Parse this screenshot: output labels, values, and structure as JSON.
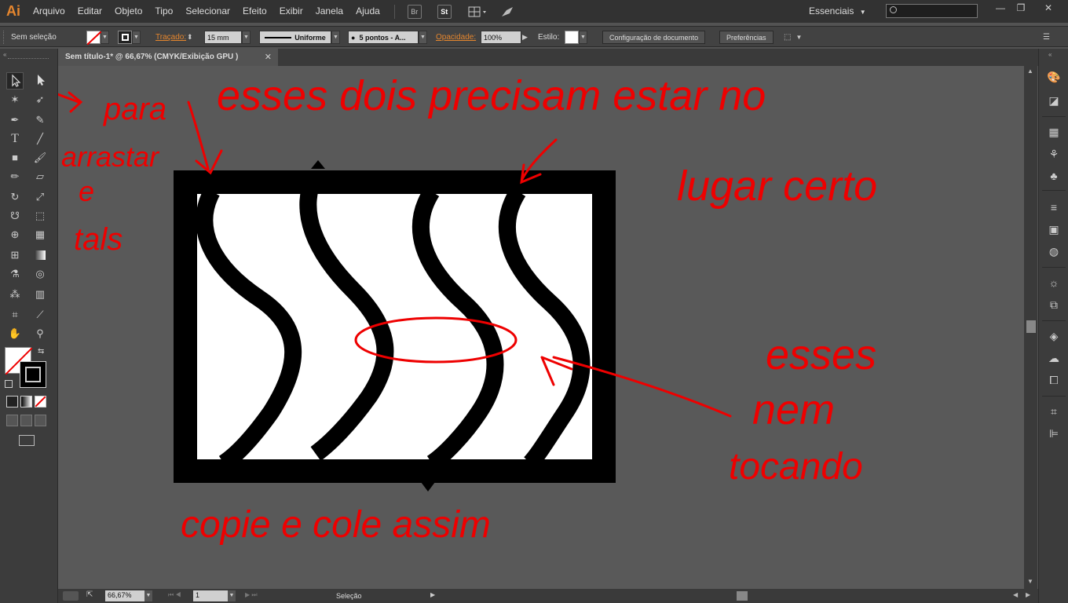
{
  "app": {
    "logo": "Ai"
  },
  "menu": [
    "Arquivo",
    "Editar",
    "Objeto",
    "Tipo",
    "Selecionar",
    "Efeito",
    "Exibir",
    "Janela",
    "Ajuda"
  ],
  "menubar_buttons": [
    "Br",
    "St"
  ],
  "workspace": "Essenciais",
  "control": {
    "selection": "Sem seleção",
    "stroke_label": "Traçado:",
    "stroke_value": "15 mm",
    "profile": "Uniforme",
    "brush": "5 pontos - A...",
    "opacity_label": "Opacidade:",
    "opacity_value": "100%",
    "style_label": "Estilo:",
    "doc_setup": "Configuração de documento",
    "prefs": "Preferências"
  },
  "document": {
    "tab_title": "Sem título-1* @ 66,67% (CMYK/Exibição GPU )",
    "close": "✕"
  },
  "status": {
    "zoom": "66,67%",
    "artboard": "1",
    "tool": "Seleção"
  },
  "annotations": {
    "arrow_note_1": "para",
    "arrow_note_2": "arrastar",
    "arrow_note_3": "e",
    "arrow_note_4": "tals",
    "top_note": "esses dois precisam estar no",
    "top_note_2": "lugar certo",
    "right_note_1": "esses",
    "right_note_2": "nem",
    "right_note_3": "tocando",
    "bottom_note": "copie e cole assim"
  },
  "colors": {
    "annotation_red": "#ee0000",
    "accent_orange": "#e5862e"
  },
  "icons": {
    "toolbox": [
      "selection-tool",
      "direct-selection-tool",
      "magic-wand-tool",
      "lasso-tool",
      "pen-tool",
      "curvature-tool",
      "type-tool",
      "line-tool",
      "rectangle-tool",
      "paintbrush-tool",
      "pencil-tool",
      "eraser-tool",
      "rotate-tool",
      "scale-tool",
      "warp-tool",
      "free-transform-tool",
      "shape-builder-tool",
      "perspective-grid-tool",
      "mesh-tool",
      "gradient-tool",
      "eyedropper-tool",
      "blend-tool",
      "symbol-sprayer-tool",
      "column-graph-tool",
      "artboard-tool",
      "slice-tool",
      "hand-tool",
      "zoom-tool"
    ],
    "panels": [
      "color-panel",
      "color-guide-panel",
      "swatches-panel",
      "brushes-panel",
      "symbols-panel",
      "stroke-panel",
      "gradient-panel",
      "transparency-panel",
      "appearance-panel",
      "graphic-styles-panel",
      "layers-panel",
      "libraries-panel",
      "asset-export-panel",
      "transform-panel",
      "align-panel"
    ]
  }
}
